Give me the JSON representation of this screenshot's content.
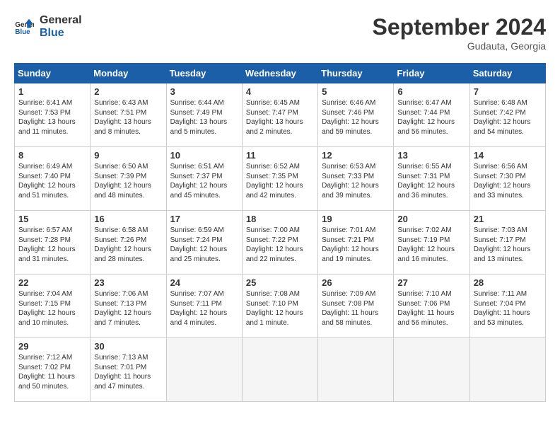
{
  "header": {
    "logo_line1": "General",
    "logo_line2": "Blue",
    "month": "September 2024",
    "location": "Gudauta, Georgia"
  },
  "columns": [
    "Sunday",
    "Monday",
    "Tuesday",
    "Wednesday",
    "Thursday",
    "Friday",
    "Saturday"
  ],
  "weeks": [
    [
      {
        "day": "1",
        "lines": [
          "Sunrise: 6:41 AM",
          "Sunset: 7:53 PM",
          "Daylight: 13 hours",
          "and 11 minutes."
        ]
      },
      {
        "day": "2",
        "lines": [
          "Sunrise: 6:43 AM",
          "Sunset: 7:51 PM",
          "Daylight: 13 hours",
          "and 8 minutes."
        ]
      },
      {
        "day": "3",
        "lines": [
          "Sunrise: 6:44 AM",
          "Sunset: 7:49 PM",
          "Daylight: 13 hours",
          "and 5 minutes."
        ]
      },
      {
        "day": "4",
        "lines": [
          "Sunrise: 6:45 AM",
          "Sunset: 7:47 PM",
          "Daylight: 13 hours",
          "and 2 minutes."
        ]
      },
      {
        "day": "5",
        "lines": [
          "Sunrise: 6:46 AM",
          "Sunset: 7:46 PM",
          "Daylight: 12 hours",
          "and 59 minutes."
        ]
      },
      {
        "day": "6",
        "lines": [
          "Sunrise: 6:47 AM",
          "Sunset: 7:44 PM",
          "Daylight: 12 hours",
          "and 56 minutes."
        ]
      },
      {
        "day": "7",
        "lines": [
          "Sunrise: 6:48 AM",
          "Sunset: 7:42 PM",
          "Daylight: 12 hours",
          "and 54 minutes."
        ]
      }
    ],
    [
      {
        "day": "8",
        "lines": [
          "Sunrise: 6:49 AM",
          "Sunset: 7:40 PM",
          "Daylight: 12 hours",
          "and 51 minutes."
        ]
      },
      {
        "day": "9",
        "lines": [
          "Sunrise: 6:50 AM",
          "Sunset: 7:39 PM",
          "Daylight: 12 hours",
          "and 48 minutes."
        ]
      },
      {
        "day": "10",
        "lines": [
          "Sunrise: 6:51 AM",
          "Sunset: 7:37 PM",
          "Daylight: 12 hours",
          "and 45 minutes."
        ]
      },
      {
        "day": "11",
        "lines": [
          "Sunrise: 6:52 AM",
          "Sunset: 7:35 PM",
          "Daylight: 12 hours",
          "and 42 minutes."
        ]
      },
      {
        "day": "12",
        "lines": [
          "Sunrise: 6:53 AM",
          "Sunset: 7:33 PM",
          "Daylight: 12 hours",
          "and 39 minutes."
        ]
      },
      {
        "day": "13",
        "lines": [
          "Sunrise: 6:55 AM",
          "Sunset: 7:31 PM",
          "Daylight: 12 hours",
          "and 36 minutes."
        ]
      },
      {
        "day": "14",
        "lines": [
          "Sunrise: 6:56 AM",
          "Sunset: 7:30 PM",
          "Daylight: 12 hours",
          "and 33 minutes."
        ]
      }
    ],
    [
      {
        "day": "15",
        "lines": [
          "Sunrise: 6:57 AM",
          "Sunset: 7:28 PM",
          "Daylight: 12 hours",
          "and 31 minutes."
        ]
      },
      {
        "day": "16",
        "lines": [
          "Sunrise: 6:58 AM",
          "Sunset: 7:26 PM",
          "Daylight: 12 hours",
          "and 28 minutes."
        ]
      },
      {
        "day": "17",
        "lines": [
          "Sunrise: 6:59 AM",
          "Sunset: 7:24 PM",
          "Daylight: 12 hours",
          "and 25 minutes."
        ]
      },
      {
        "day": "18",
        "lines": [
          "Sunrise: 7:00 AM",
          "Sunset: 7:22 PM",
          "Daylight: 12 hours",
          "and 22 minutes."
        ]
      },
      {
        "day": "19",
        "lines": [
          "Sunrise: 7:01 AM",
          "Sunset: 7:21 PM",
          "Daylight: 12 hours",
          "and 19 minutes."
        ]
      },
      {
        "day": "20",
        "lines": [
          "Sunrise: 7:02 AM",
          "Sunset: 7:19 PM",
          "Daylight: 12 hours",
          "and 16 minutes."
        ]
      },
      {
        "day": "21",
        "lines": [
          "Sunrise: 7:03 AM",
          "Sunset: 7:17 PM",
          "Daylight: 12 hours",
          "and 13 minutes."
        ]
      }
    ],
    [
      {
        "day": "22",
        "lines": [
          "Sunrise: 7:04 AM",
          "Sunset: 7:15 PM",
          "Daylight: 12 hours",
          "and 10 minutes."
        ]
      },
      {
        "day": "23",
        "lines": [
          "Sunrise: 7:06 AM",
          "Sunset: 7:13 PM",
          "Daylight: 12 hours",
          "and 7 minutes."
        ]
      },
      {
        "day": "24",
        "lines": [
          "Sunrise: 7:07 AM",
          "Sunset: 7:11 PM",
          "Daylight: 12 hours",
          "and 4 minutes."
        ]
      },
      {
        "day": "25",
        "lines": [
          "Sunrise: 7:08 AM",
          "Sunset: 7:10 PM",
          "Daylight: 12 hours",
          "and 1 minute."
        ]
      },
      {
        "day": "26",
        "lines": [
          "Sunrise: 7:09 AM",
          "Sunset: 7:08 PM",
          "Daylight: 11 hours",
          "and 58 minutes."
        ]
      },
      {
        "day": "27",
        "lines": [
          "Sunrise: 7:10 AM",
          "Sunset: 7:06 PM",
          "Daylight: 11 hours",
          "and 56 minutes."
        ]
      },
      {
        "day": "28",
        "lines": [
          "Sunrise: 7:11 AM",
          "Sunset: 7:04 PM",
          "Daylight: 11 hours",
          "and 53 minutes."
        ]
      }
    ],
    [
      {
        "day": "29",
        "lines": [
          "Sunrise: 7:12 AM",
          "Sunset: 7:02 PM",
          "Daylight: 11 hours",
          "and 50 minutes."
        ]
      },
      {
        "day": "30",
        "lines": [
          "Sunrise: 7:13 AM",
          "Sunset: 7:01 PM",
          "Daylight: 11 hours",
          "and 47 minutes."
        ]
      },
      null,
      null,
      null,
      null,
      null
    ]
  ]
}
